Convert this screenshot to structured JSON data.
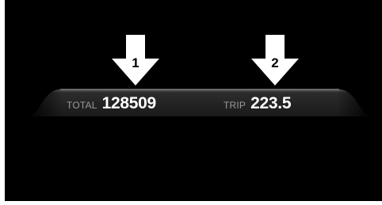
{
  "callouts": [
    {
      "number": "1"
    },
    {
      "number": "2"
    }
  ],
  "odometer": {
    "total_label": "TOTAL",
    "total_value": "128509",
    "trip_label": "TRIP",
    "trip_value": "223.5"
  },
  "colors": {
    "background": "#000000",
    "arrow": "#ffffff",
    "label": "#9a9a9a",
    "value": "#ffffff"
  },
  "icons": {
    "callout_arrow": "down-arrow-icon"
  }
}
